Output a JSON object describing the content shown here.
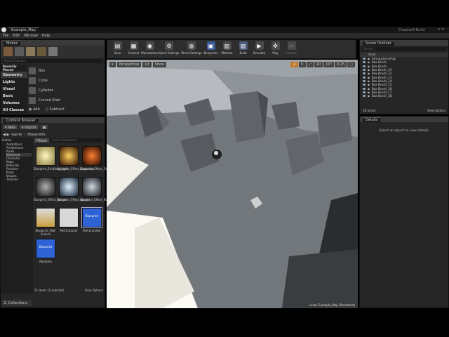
{
  "window": {
    "tab": "Example_Map",
    "project": "Chapter6-Build"
  },
  "menu": [
    "File",
    "Edit",
    "Window",
    "Help"
  ],
  "modes": {
    "title": "Modes",
    "search_placeholder": "Search Classes",
    "categories": [
      "Recently Placed",
      "Geometry",
      "Lights",
      "Visual",
      "Basic",
      "Volumes",
      "All Classes"
    ],
    "items": [
      "Box",
      "Cone",
      "Cylinder",
      "Curved Stair"
    ],
    "add_label": "Add",
    "subtract_label": "Subtract"
  },
  "toolbar": [
    "Save",
    "Content",
    "Marketplace",
    "Quick Settings",
    "World Settings",
    "Blueprints",
    "Matinee",
    "Build",
    "Simulate",
    "Play",
    "Launch"
  ],
  "viewport": {
    "perspective": "Perspective",
    "lit": "Lit",
    "show": "Show",
    "snap_angle": "10°",
    "scale": "0.25",
    "grid": "10",
    "level": "Level: Example_Map (Persistent)"
  },
  "content_browser": {
    "title": "Content Browser",
    "new_label": "New",
    "import_label": "Import",
    "path": [
      "Game",
      "Blueprints"
    ],
    "filters_label": "Filters",
    "search_placeholder": "Search Blueprints",
    "tree": [
      "Game",
      "Animations",
      "Architecture",
      "Audio",
      "Blueprints",
      "Character",
      "Maps",
      "Materials",
      "Particles",
      "Props",
      "Shapes",
      "Textures"
    ],
    "assets": [
      "Blueprint_Emitting_Light",
      "Blueprint_Effect_Explosion",
      "Blueprint_Effect_Fire",
      "Blueprint_Effect_Smoke",
      "Blueprint_Effect_Sparks",
      "Blueprint_Effect_Steam",
      "Blueprint_Wall Sconce",
      "MyCharacter",
      "MyController",
      "MyGame"
    ],
    "thumb_caption": "Blueprint",
    "status": "11 items (1 selected)",
    "view_options": "View Options",
    "collections": "Collections"
  },
  "outliner": {
    "title": "Scene Outliner",
    "search_placeholder": "Search...",
    "col": "Actor",
    "actors": [
      "AtmosphericFog",
      "Box Brush",
      "Box Brush",
      "Box Brush_11",
      "Box Brush_12",
      "Box Brush_13",
      "Box Brush_14",
      "Box Brush_15",
      "Box Brush_16",
      "Box Brush_17",
      "Box Brush_18"
    ],
    "count": "58 actors",
    "view_options": "View Options"
  },
  "details": {
    "title": "Details",
    "empty_msg": "Select an object to view details."
  },
  "colors": {
    "bg": "#262626",
    "accent": "#2e63d6"
  }
}
